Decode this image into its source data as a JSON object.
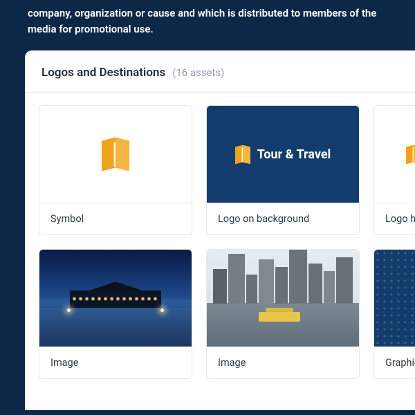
{
  "intro": "company, organization or cause and which is distributed to members of the media for promotional use.",
  "section": {
    "title": "Logos and Destinations",
    "count_label": "(16 assets)"
  },
  "brand": {
    "logotype": "Tour & Travel"
  },
  "cards": {
    "row1": [
      {
        "caption": "Symbol"
      },
      {
        "caption": "Logo on background"
      },
      {
        "caption": "Logo hor"
      }
    ],
    "row2": [
      {
        "caption": "Image"
      },
      {
        "caption": "Image"
      },
      {
        "caption": "Graphic"
      }
    ]
  }
}
